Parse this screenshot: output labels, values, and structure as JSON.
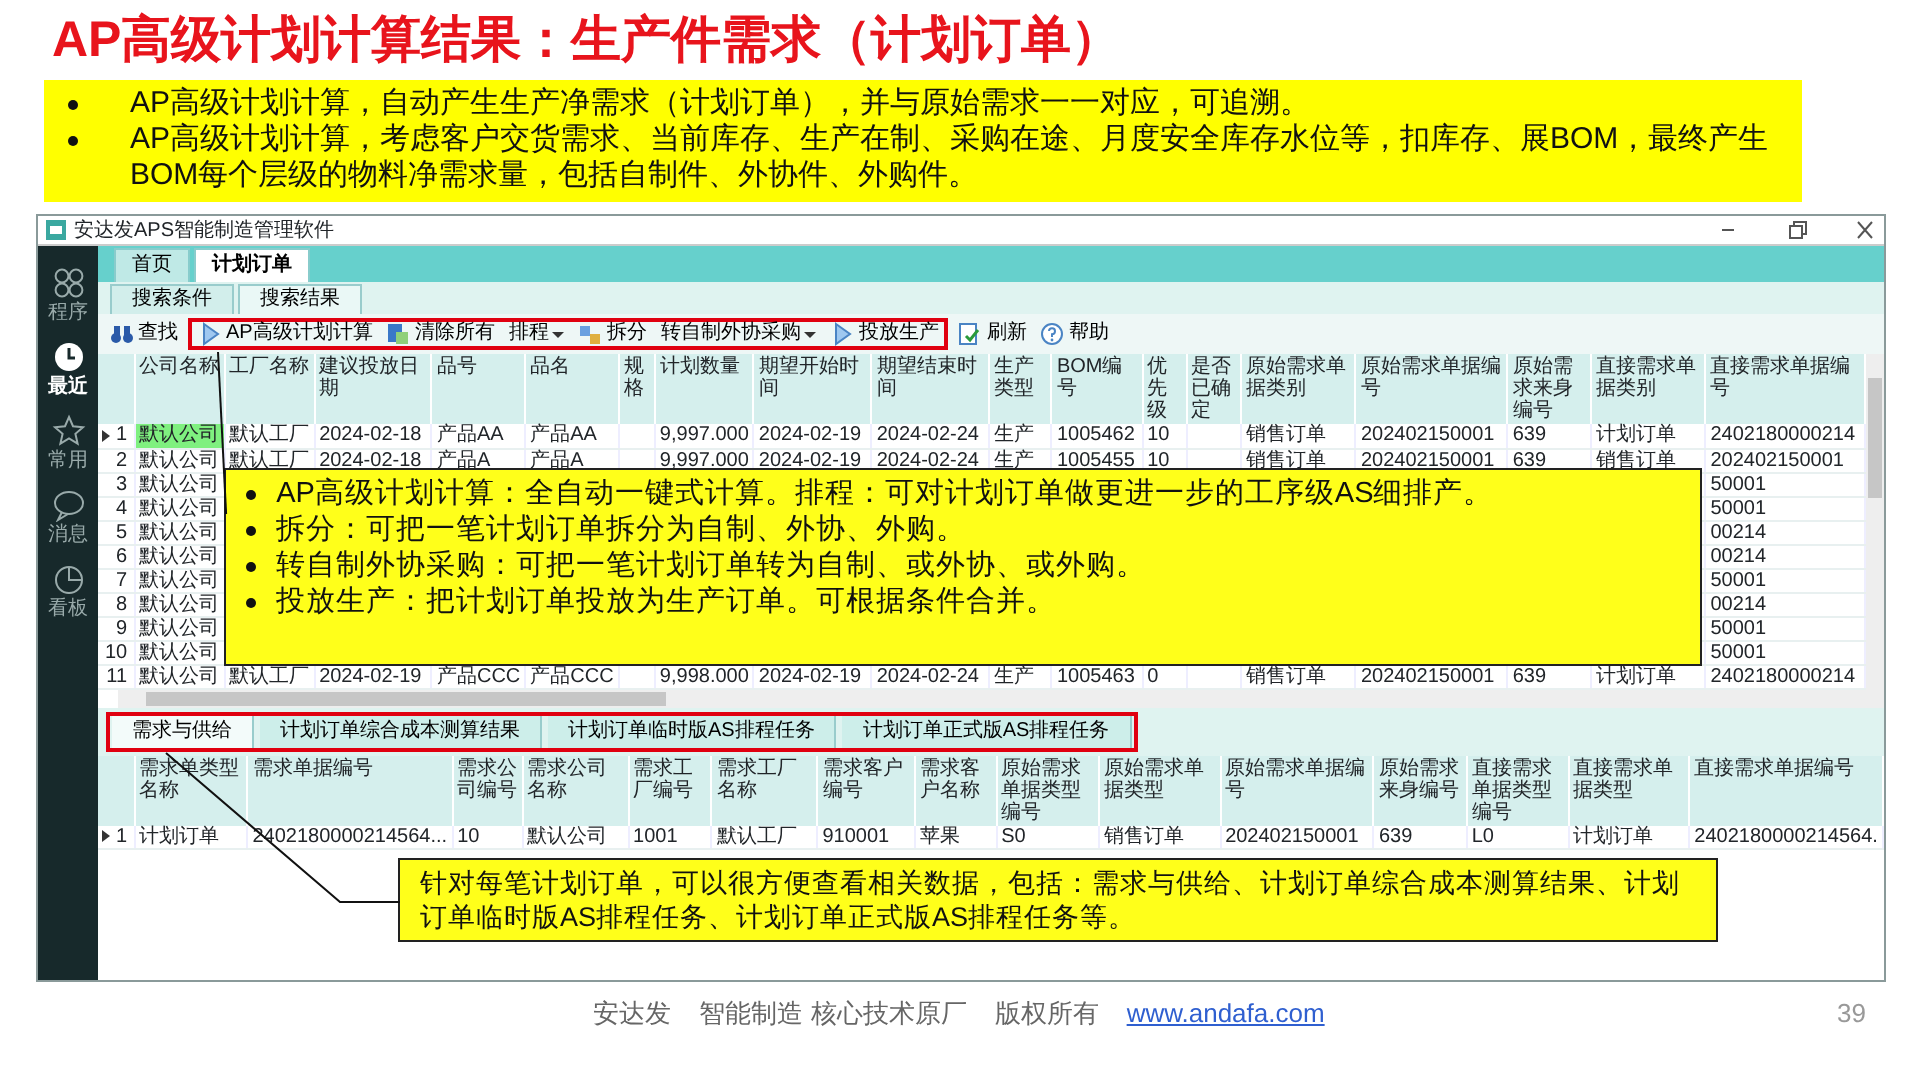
{
  "slide": {
    "title": "AP高级计划计算结果：生产件需求（计划订单）",
    "bullets": [
      "AP高级计划计算，自动产生生产净需求（计划订单），并与原始需求一一对应，可追溯。",
      "AP高级计划计算，考虑客户交货需求、当前库存、生产在制、采购在途、月度安全库存水位等，扣库存、展BOM，最终产生BOM每个层级的物料净需求量，包括自制件、外协件、外购件。"
    ],
    "footer": [
      "安达发",
      "智能制造 核心技术原厂",
      "版权所有"
    ],
    "footer_link": "www.andafa.com",
    "page_number": "39"
  },
  "window": {
    "title": "安达发APS智能制造管理软件",
    "sidebar": [
      {
        "label": "程序",
        "kind": "programs",
        "selected": false
      },
      {
        "label": "最近",
        "kind": "recent",
        "selected": true
      },
      {
        "label": "常用",
        "kind": "favorites",
        "selected": false
      },
      {
        "label": "消息",
        "kind": "messages",
        "selected": false
      },
      {
        "label": "看板",
        "kind": "dashboard",
        "selected": false
      }
    ],
    "tabs": [
      {
        "label": "首页",
        "selected": false
      },
      {
        "label": "计划订单",
        "selected": true
      }
    ],
    "subtabs": [
      {
        "label": "搜索条件",
        "selected": false
      },
      {
        "label": "搜索结果",
        "selected": true
      }
    ],
    "toolbar": [
      {
        "label": "查找",
        "kind": "find",
        "highlighted": false
      },
      {
        "label": "AP高级计划计算",
        "kind": "run",
        "highlighted": true
      },
      {
        "label": "清除所有",
        "kind": "clear",
        "highlighted": true
      },
      {
        "label": "排程",
        "kind": "menu",
        "highlighted": true
      },
      {
        "label": "拆分",
        "kind": "split",
        "highlighted": true
      },
      {
        "label": "转自制外协采购",
        "kind": "menu",
        "highlighted": true
      },
      {
        "label": "投放生产",
        "kind": "run",
        "highlighted": true
      },
      {
        "label": "刷新",
        "kind": "refresh",
        "highlighted": false
      },
      {
        "label": "帮助",
        "kind": "help",
        "highlighted": false
      }
    ],
    "grid": {
      "columns": [
        "公司名称",
        "工厂名称",
        "建议投放日期",
        "品号",
        "品名",
        "规格",
        "计划数量",
        "期望开始时间",
        "期望结束时间",
        "生产类型",
        "BOM编号",
        "优先级",
        "是否已确定",
        "原始需求单据类别",
        "原始需求单据编号",
        "原始需求来身编号",
        "直接需求单据类别",
        "直接需求单据编号"
      ],
      "rows": [
        {
          "number": "1",
          "current": true,
          "cells": [
            "默认公司",
            "默认工厂",
            "2024-02-18",
            "产品AA",
            "产品AA",
            null,
            "9,997.000",
            "2024-02-19",
            "2024-02-24",
            "生产",
            "1005462",
            "10",
            null,
            "销售订单",
            "202402150001",
            "639",
            "计划订单",
            "2402180000214"
          ]
        },
        {
          "number": "2",
          "current": false,
          "cells": [
            "默认公司",
            "默认工厂",
            "2024-02-18",
            "产品A",
            "产品A",
            null,
            "9,997.000",
            "2024-02-19",
            "2024-02-24",
            "生产",
            "1005455",
            "10",
            null,
            "销售订单",
            "202402150001",
            "639",
            "销售订单",
            "202402150001"
          ]
        },
        {
          "number": "3",
          "current": false,
          "cells": [
            "默认公司",
            null,
            null,
            null,
            null,
            null,
            null,
            null,
            null,
            null,
            null,
            null,
            null,
            null,
            null,
            null,
            null,
            "50001"
          ]
        },
        {
          "number": "4",
          "current": false,
          "cells": [
            "默认公司",
            null,
            null,
            null,
            null,
            null,
            null,
            null,
            null,
            null,
            null,
            null,
            null,
            null,
            null,
            null,
            null,
            "50001"
          ]
        },
        {
          "number": "5",
          "current": false,
          "cells": [
            "默认公司",
            null,
            null,
            null,
            null,
            null,
            null,
            null,
            null,
            null,
            null,
            null,
            null,
            null,
            null,
            null,
            null,
            "00214"
          ]
        },
        {
          "number": "6",
          "current": false,
          "cells": [
            "默认公司",
            null,
            null,
            null,
            null,
            null,
            null,
            null,
            null,
            null,
            null,
            null,
            null,
            null,
            null,
            null,
            null,
            "00214"
          ]
        },
        {
          "number": "7",
          "current": false,
          "cells": [
            "默认公司",
            null,
            null,
            null,
            null,
            null,
            null,
            null,
            null,
            null,
            null,
            null,
            null,
            null,
            null,
            null,
            null,
            "50001"
          ]
        },
        {
          "number": "8",
          "current": false,
          "cells": [
            "默认公司",
            null,
            null,
            null,
            null,
            null,
            null,
            null,
            null,
            null,
            null,
            null,
            null,
            null,
            null,
            null,
            null,
            "00214"
          ]
        },
        {
          "number": "9",
          "current": false,
          "cells": [
            "默认公司",
            null,
            null,
            null,
            null,
            null,
            null,
            null,
            null,
            null,
            null,
            null,
            null,
            null,
            null,
            null,
            null,
            "50001"
          ]
        },
        {
          "number": "10",
          "current": false,
          "cells": [
            "默认公司",
            null,
            null,
            null,
            null,
            null,
            null,
            null,
            null,
            null,
            null,
            null,
            null,
            null,
            null,
            null,
            null,
            "50001"
          ]
        },
        {
          "number": "11",
          "current": false,
          "cells": [
            "默认公司",
            "默认工厂",
            "2024-02-19",
            "产品CCC",
            "产品CCC",
            null,
            "9,998.000",
            "2024-02-19",
            "2024-02-24",
            "生产",
            "1005463",
            "0",
            null,
            "销售订单",
            "202402150001",
            "639",
            "计划订单",
            "2402180000214"
          ]
        }
      ]
    },
    "detail_tabs": [
      {
        "label": "需求与供给",
        "selected": true,
        "highlighted": true
      },
      {
        "label": "计划订单综合成本测算结果",
        "selected": false,
        "highlighted": true
      },
      {
        "label": "计划订单临时版AS排程任务",
        "selected": false,
        "highlighted": true
      },
      {
        "label": "计划订单正式版AS排程任务",
        "selected": false,
        "highlighted": true
      }
    ],
    "detail_grid": {
      "columns": [
        "需求单类型名称",
        "需求单据编号",
        "需求公司编号",
        "需求公司名称",
        "需求工厂编号",
        "需求工厂名称",
        "需求客户编号",
        "需求客户名称",
        "原始需求单据类型编号",
        "原始需求单据类型",
        "原始需求单据编号",
        "原始需求来身编号",
        "直接需求单据类型编号",
        "直接需求单据类型",
        "直接需求单据编号"
      ],
      "rows": [
        {
          "number": "1",
          "current": true,
          "cells": [
            "计划订单",
            "2402180000214564...",
            "10",
            "默认公司",
            "1001",
            "默认工厂",
            "910001",
            "苹果",
            "S0",
            "销售订单",
            "202402150001",
            "639",
            "L0",
            "计划订单",
            "2402180000214564."
          ]
        }
      ]
    }
  },
  "callouts": {
    "toolbar_notes": [
      "AP高级计划计算：全自动一键式计算。排程：可对计划订单做更进一步的工序级AS细排产。",
      "拆分：可把一笔计划订单拆分为自制、外协、外购。",
      "转自制外协采购：可把一笔计划订单转为自制、或外协、或外购。",
      "投放生产：把计划订单投放为生产订单。可根据条件合并。"
    ],
    "detail_note": "针对每笔计划订单，可以很方便查看相关数据，包括：需求与供给、计划订单综合成本测算结果、计划订单临时版AS排程任务、计划订单正式版AS排程任务等。"
  }
}
